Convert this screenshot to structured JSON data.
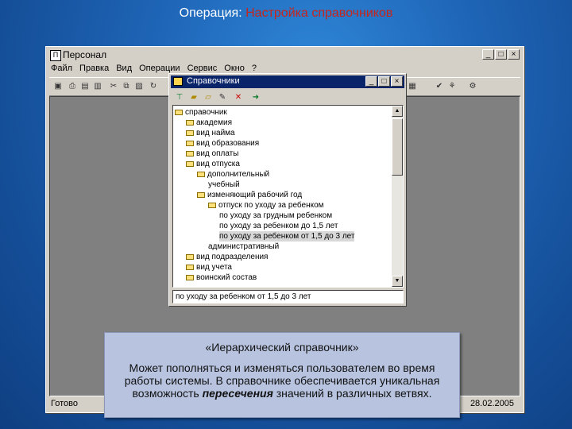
{
  "slide": {
    "title_prefix": "Операция:",
    "title_accent": "Настройка справочников"
  },
  "app_window": {
    "title": "Персонал",
    "menu": [
      "Файл",
      "Правка",
      "Вид",
      "Операции",
      "Сервис",
      "Окно",
      "?"
    ],
    "status_left": "Готово",
    "status_right": "28.02.2005"
  },
  "child_window": {
    "title": "Справочники",
    "selected_value": "по уходу за ребенком от 1,5 до 3 лет",
    "tree": [
      {
        "label": "справочник",
        "level": 0,
        "folder": true
      },
      {
        "label": "академия",
        "level": 1,
        "folder": true
      },
      {
        "label": "вид найма",
        "level": 1,
        "folder": true
      },
      {
        "label": "вид образования",
        "level": 1,
        "folder": true
      },
      {
        "label": "вид оплаты",
        "level": 1,
        "folder": true
      },
      {
        "label": "вид отпуска",
        "level": 1,
        "folder": true
      },
      {
        "label": "дополнительный",
        "level": 2,
        "folder": true
      },
      {
        "label": "учебный",
        "level": 3,
        "folder": false
      },
      {
        "label": "изменяющий рабочий год",
        "level": 2,
        "folder": true
      },
      {
        "label": "отпуск по уходу за ребенком",
        "level": 3,
        "folder": true
      },
      {
        "label": "по уходу за грудным ребенком",
        "level": 4,
        "folder": false
      },
      {
        "label": "по уходу за ребенком до 1,5 лет",
        "level": 4,
        "folder": false
      },
      {
        "label": "по уходу за ребенком от 1,5 до 3 лет",
        "level": 4,
        "folder": false,
        "selected": true
      },
      {
        "label": "административный",
        "level": 3,
        "folder": false
      },
      {
        "label": "вид подразделения",
        "level": 1,
        "folder": true
      },
      {
        "label": "вид учета",
        "level": 1,
        "folder": true
      },
      {
        "label": "воинский состав",
        "level": 1,
        "folder": true
      }
    ]
  },
  "callout": {
    "heading": "«Иерархический справочник»",
    "body_1": "Может пополняться и изменяться пользователем во время работы системы. В справочнике обеспечивается уникальная возможность",
    "body_em": "пересечения",
    "body_2": "значений в различных ветвях."
  },
  "colors": {
    "accent": "#c4261e",
    "titlebar_active": "#0a246a",
    "window_face": "#d4d0c8",
    "callout_bg": "#b7c3df"
  }
}
